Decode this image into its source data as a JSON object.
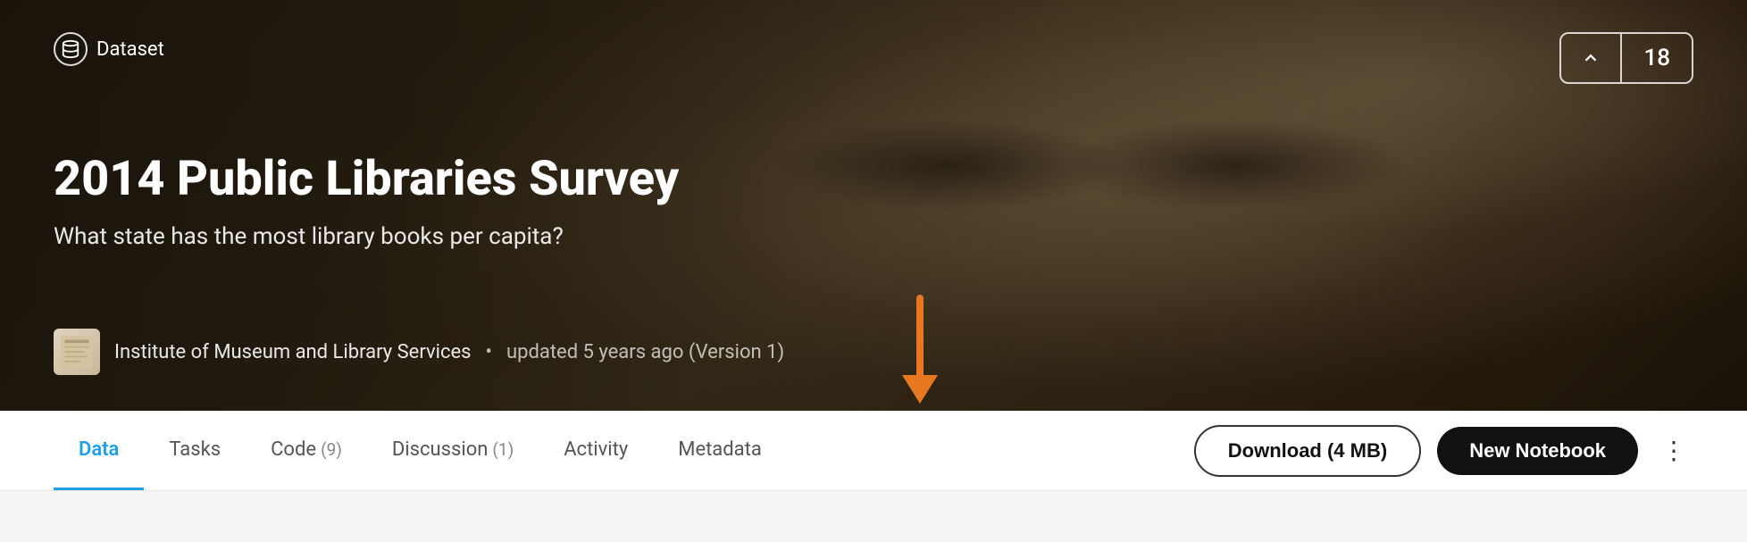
{
  "hero": {
    "badge": "Dataset",
    "title": "2014 Public Libraries Survey",
    "subtitle": "What state has the most library books per capita?",
    "author": "Institute of Museum and Library Services",
    "updated": "updated 5 years ago (Version 1)",
    "upvote_count": "18"
  },
  "nav": {
    "tabs": [
      {
        "label": "Data",
        "badge": "",
        "active": true
      },
      {
        "label": "Tasks",
        "badge": "",
        "active": false
      },
      {
        "label": "Code",
        "badge": "(9)",
        "active": false
      },
      {
        "label": "Discussion",
        "badge": "(1)",
        "active": false
      },
      {
        "label": "Activity",
        "badge": "",
        "active": false
      },
      {
        "label": "Metadata",
        "badge": "",
        "active": false
      }
    ],
    "download_label": "Download (4 MB)",
    "new_notebook_label": "New Notebook",
    "more_icon": "⋮"
  }
}
